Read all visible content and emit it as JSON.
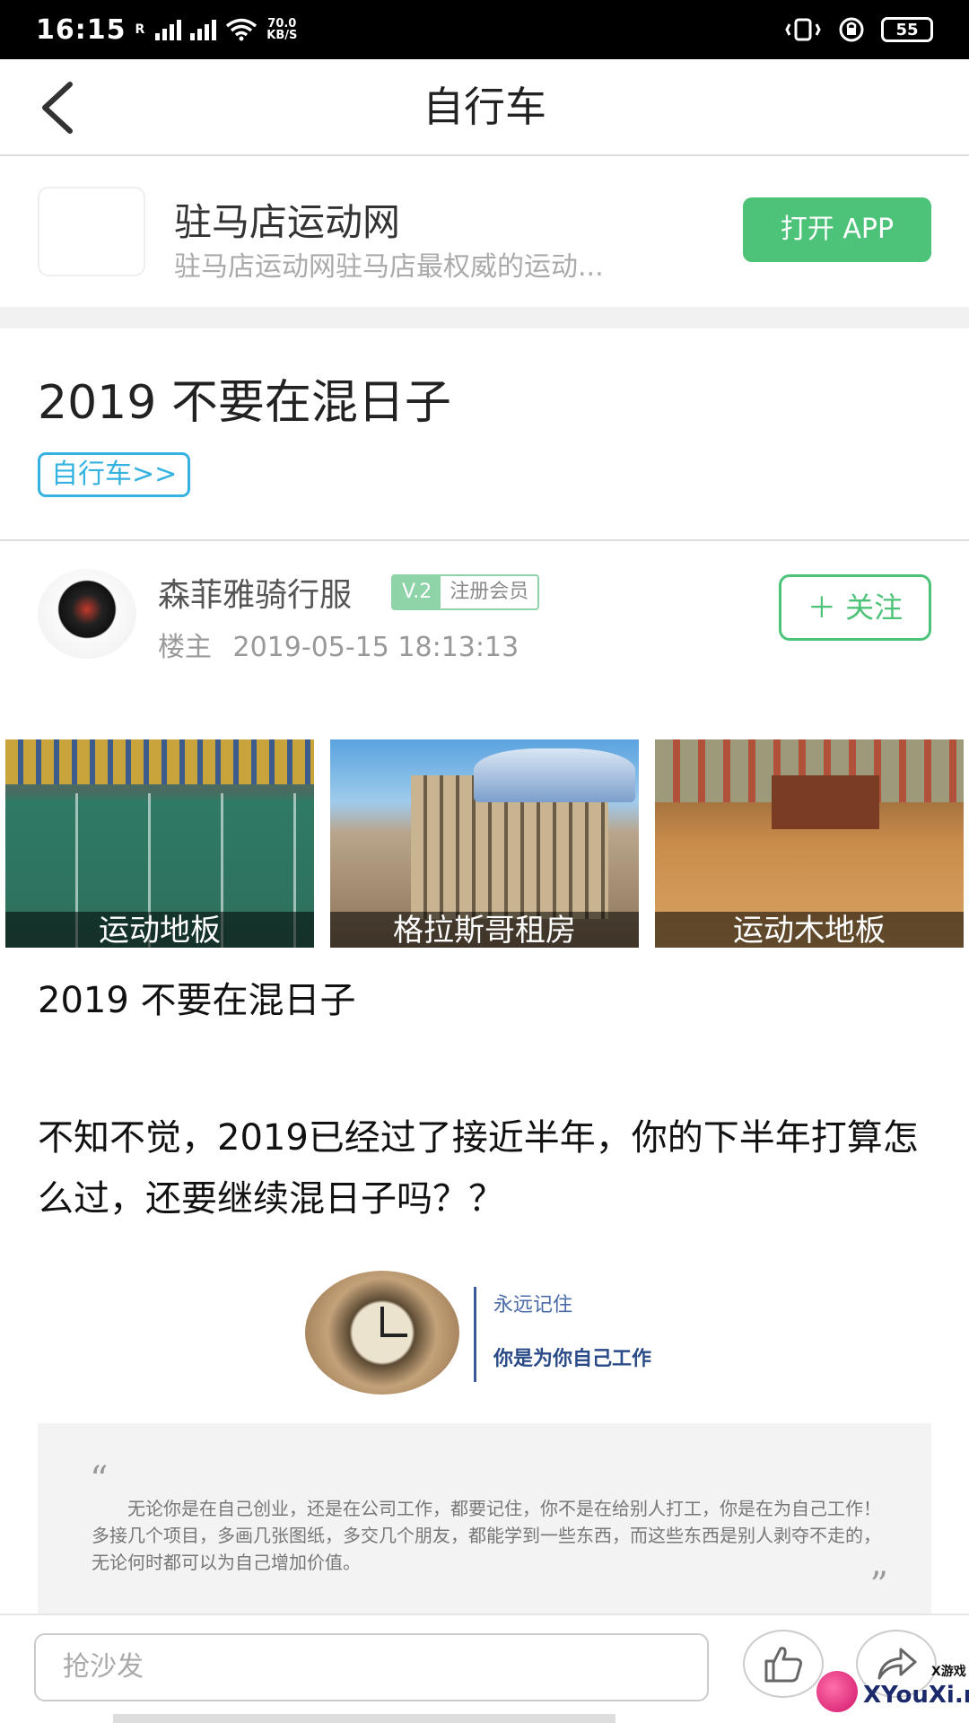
{
  "status_bar": {
    "time": "16:15",
    "carrier_r": "R",
    "net_speed_value": "70.0",
    "net_speed_unit": "KB/S",
    "battery": "55"
  },
  "nav": {
    "title": "自行车"
  },
  "app_banner": {
    "name": "驻马店运动网",
    "desc": "驻马店运动网驻马店最权威的运动...",
    "open_label": "打开 APP"
  },
  "post": {
    "title": "2019 不要在混日子",
    "category_tag": "自行车>>"
  },
  "author": {
    "name": "森菲雅骑行服",
    "level": "V.2",
    "role": "注册会员",
    "position": "楼主",
    "timestamp": "2019-05-15 18:13:13",
    "follow_label": "＋ 关注"
  },
  "ads": [
    {
      "caption": "运动地板"
    },
    {
      "caption": "格拉斯哥租房"
    },
    {
      "caption": "运动木地板"
    }
  ],
  "content": {
    "title": "2019 不要在混日子",
    "paragraph": "不知不觉，2019已经过了接近半年，你的下半年打算怎么过，还要继续混日子吗？？",
    "banner_line1": "永远记住",
    "banner_line2": "你是为你自己工作",
    "quote_open": "“",
    "quote_text": "无论你是在自己创业，还是在公司工作，都要记住，你不是在给别人打工，你是在为自己工作！多接几个项目，多画几张图纸，多交几个朋友，都能学到一些东西，而这些东西是别人剥夺不走的，无论何时都可以为自己增加价值。",
    "quote_close": "”"
  },
  "bottom_bar": {
    "comment_placeholder": "抢沙发",
    "like_icon": "thumbs-up-icon",
    "share_icon": "share-icon"
  },
  "watermark": {
    "text": "XYouXi.net",
    "small": "X游戏"
  },
  "colors": {
    "accent_green": "#4cc378",
    "tag_blue": "#35b2e0"
  }
}
